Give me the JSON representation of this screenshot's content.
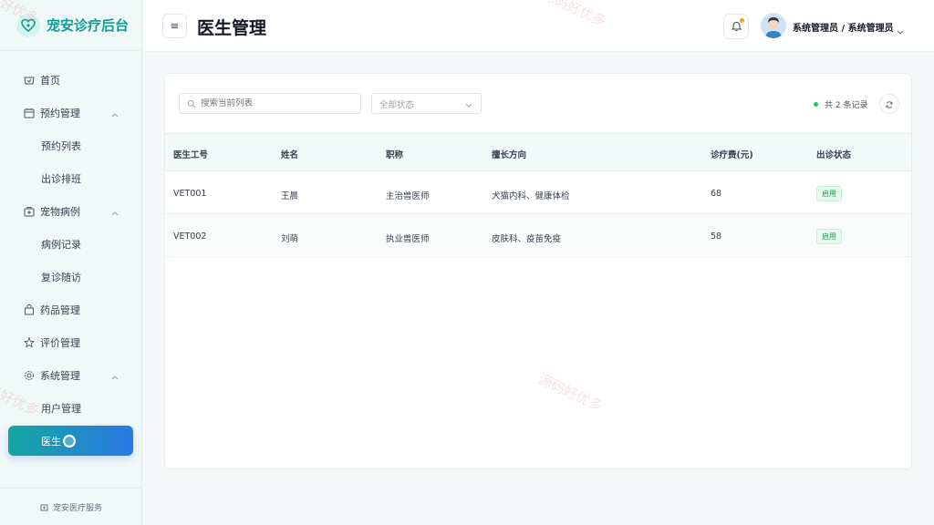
{
  "app": {
    "brand": "宠安诊疗后台",
    "footer": "宠安医疗服务",
    "accent": "#14a6a0"
  },
  "sidebar": {
    "items": [
      {
        "label": "首页",
        "icon": "home-icon"
      },
      {
        "label": "预约管理",
        "icon": "calendar-icon",
        "expanded": true
      },
      {
        "label": "预约列表"
      },
      {
        "label": "出诊排班"
      },
      {
        "label": "宠物病例",
        "icon": "medical-case-icon",
        "expanded": true
      },
      {
        "label": "病例记录"
      },
      {
        "label": "复诊随访"
      },
      {
        "label": "药品管理",
        "icon": "bag-icon"
      },
      {
        "label": "评价管理",
        "icon": "star-icon"
      },
      {
        "label": "系统管理",
        "icon": "gear-icon",
        "expanded": true
      },
      {
        "label": "用户管理"
      },
      {
        "label": "医生管理",
        "visible": "医生"
      }
    ]
  },
  "header": {
    "title": "医生管理",
    "user": "系统管理员 / 系统管理员"
  },
  "toolbar": {
    "search_placeholder": "搜索当前列表",
    "status_placeholder": "全部状态",
    "count_text": "共 2 条记录"
  },
  "table": {
    "columns": [
      "医生工号",
      "姓名",
      "职称",
      "擅长方向",
      "诊疗费(元)",
      "出诊状态"
    ],
    "rows": [
      {
        "id": "VET001",
        "name": "王晨",
        "title": "主治兽医师",
        "specialty": "犬猫内科、健康体检",
        "fee": "68",
        "status": "启用"
      },
      {
        "id": "VET002",
        "name": "刘萌",
        "title": "执业兽医师",
        "specialty": "皮肤科、疫苗免疫",
        "fee": "58",
        "status": "启用"
      }
    ]
  },
  "watermark": "源码好优多"
}
